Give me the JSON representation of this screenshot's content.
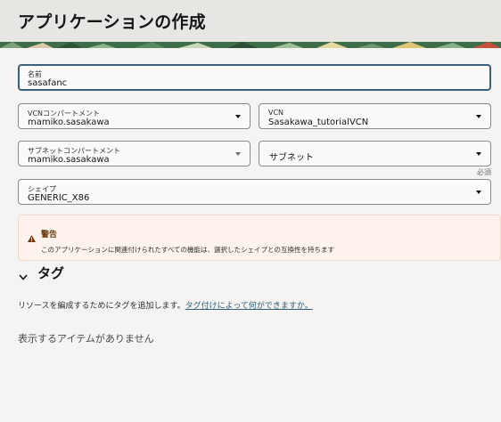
{
  "page": {
    "title": "アプリケーションの作成"
  },
  "form": {
    "name": {
      "label": "名前",
      "value": "sasafanc"
    },
    "vcn_compartment": {
      "label": "VCNコンパートメント",
      "value": "mamiko.sasakawa"
    },
    "vcn": {
      "label": "VCN",
      "value": "Sasakawa_tutorialVCN"
    },
    "subnet_compartment": {
      "label": "サブネットコンパートメント",
      "value": "mamiko.sasakawa"
    },
    "subnet": {
      "placeholder": "サブネット"
    },
    "required_note": "必須",
    "shape": {
      "label": "シェイプ",
      "value": "GENERIC_X86"
    }
  },
  "warning": {
    "title": "警告",
    "text": "このアプリケーションに関連付けられたすべての機能は、選択したシェイプとの互換性を持ちます"
  },
  "tags": {
    "title": "タグ",
    "description": "リソースを編成するためにタグを追加します。",
    "link": "タグ付けによって何ができますか。",
    "empty": "表示するアイテムがありません"
  },
  "colors": {
    "accent": "#39617a",
    "warning_bg": "#fdf3ec",
    "warning_text": "#6b3b0f",
    "link": "#2f5e78"
  }
}
